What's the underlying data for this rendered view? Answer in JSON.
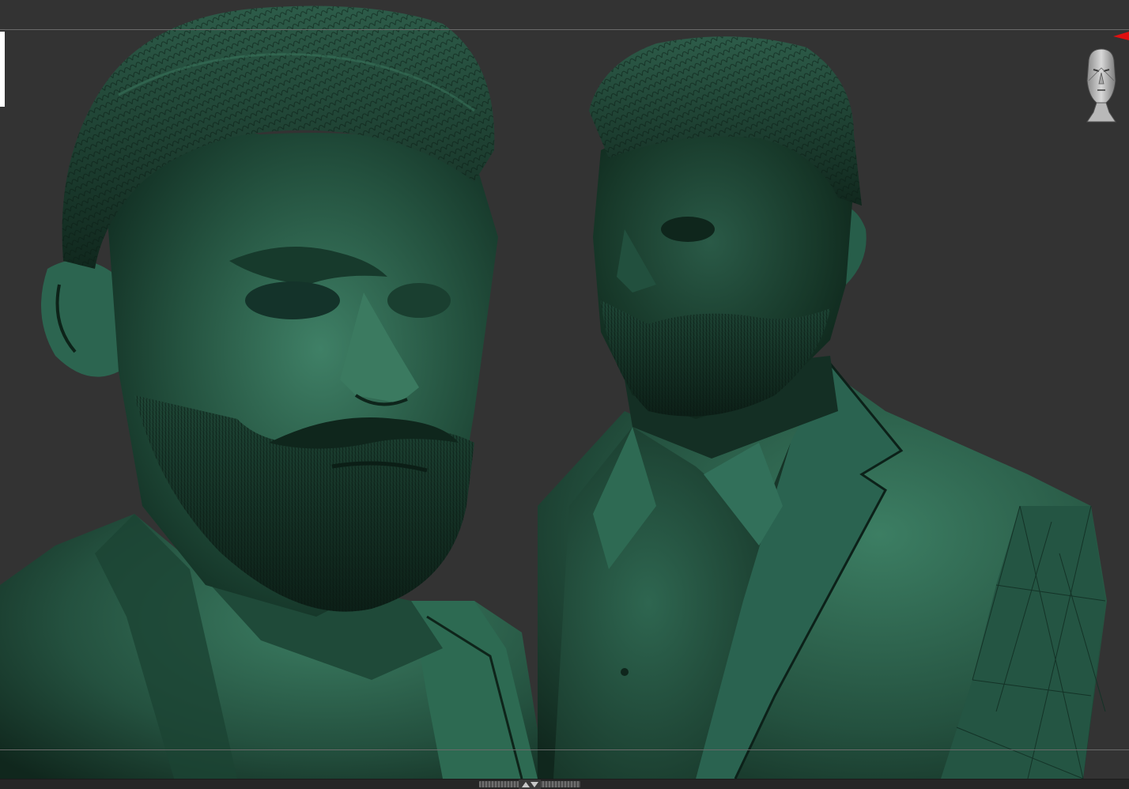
{
  "viewport": {
    "background_color": "#333333",
    "material_color": "#2f6f55",
    "objects": [
      "front-bust-closeup",
      "three-quarter-bust"
    ]
  },
  "gizmo": {
    "icon": "head-navigation-gizmo-icon",
    "axis_icon": "red-axis-arrow-icon",
    "axis_color": "#e01010"
  },
  "bottom_tray": {
    "icon": "tray-toggle-arrows-icon"
  }
}
